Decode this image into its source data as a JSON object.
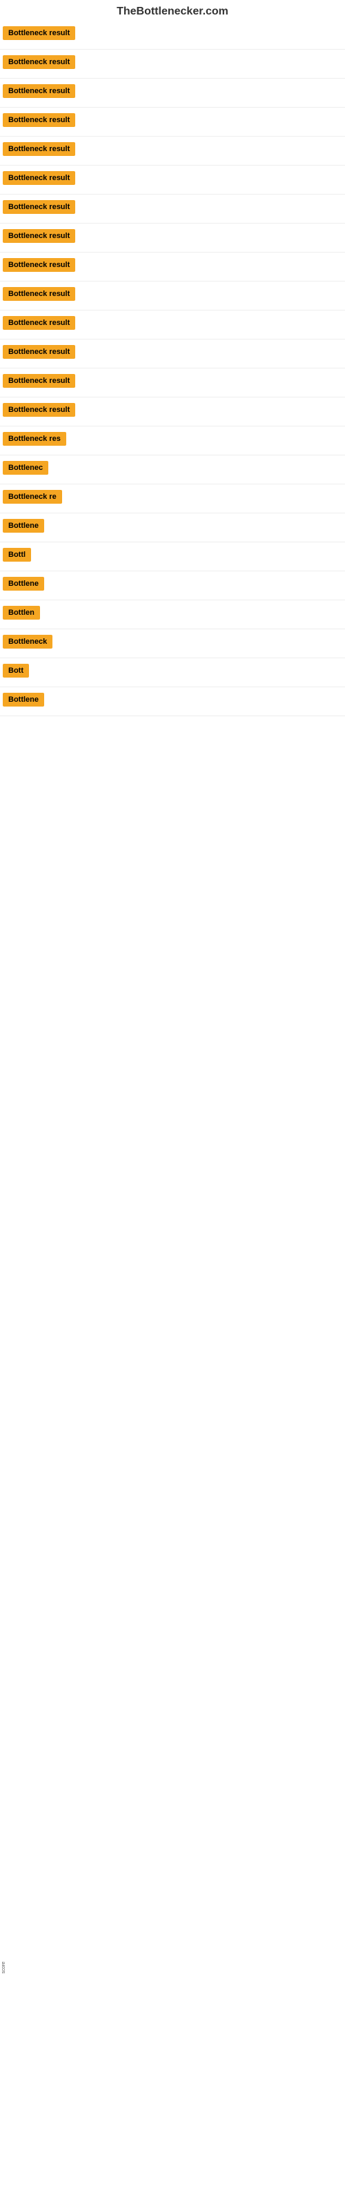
{
  "site": {
    "title": "TheBottlenecker.com"
  },
  "sections": [
    {
      "id": 1,
      "label": "Bottleneck result",
      "width": 130,
      "size": "normal"
    },
    {
      "id": 2,
      "label": "Bottleneck result",
      "width": 130,
      "size": "normal"
    },
    {
      "id": 3,
      "label": "Bottleneck result",
      "width": 130,
      "size": "normal"
    },
    {
      "id": 4,
      "label": "Bottleneck result",
      "width": 130,
      "size": "normal"
    },
    {
      "id": 5,
      "label": "Bottleneck result",
      "width": 130,
      "size": "normal"
    },
    {
      "id": 6,
      "label": "Bottleneck result",
      "width": 130,
      "size": "normal"
    },
    {
      "id": 7,
      "label": "Bottleneck result",
      "width": 130,
      "size": "normal"
    },
    {
      "id": 8,
      "label": "Bottleneck result",
      "width": 130,
      "size": "normal"
    },
    {
      "id": 9,
      "label": "Bottleneck result",
      "width": 130,
      "size": "normal"
    },
    {
      "id": 10,
      "label": "Bottleneck result",
      "width": 130,
      "size": "normal"
    },
    {
      "id": 11,
      "label": "Bottleneck result",
      "width": 130,
      "size": "normal"
    },
    {
      "id": 12,
      "label": "Bottleneck result",
      "width": 130,
      "size": "normal"
    },
    {
      "id": 13,
      "label": "Bottleneck result",
      "width": 130,
      "size": "normal"
    },
    {
      "id": 14,
      "label": "Bottleneck result",
      "width": 130,
      "size": "normal"
    },
    {
      "id": 15,
      "label": "Bottleneck res",
      "width": 110,
      "size": "normal"
    },
    {
      "id": 16,
      "label": "Bottlenec",
      "width": 80,
      "size": "normal"
    },
    {
      "id": 17,
      "label": "Bottleneck re",
      "width": 100,
      "size": "normal"
    },
    {
      "id": 18,
      "label": "Bottlene",
      "width": 72,
      "size": "normal"
    },
    {
      "id": 19,
      "label": "Bottl",
      "width": 52,
      "size": "normal"
    },
    {
      "id": 20,
      "label": "Bottlene",
      "width": 72,
      "size": "normal"
    },
    {
      "id": 21,
      "label": "Bottlen",
      "width": 65,
      "size": "normal"
    },
    {
      "id": 22,
      "label": "Bottleneck",
      "width": 85,
      "size": "normal"
    },
    {
      "id": 23,
      "label": "Bott",
      "width": 45,
      "size": "normal"
    },
    {
      "id": 24,
      "label": "Bottlene",
      "width": 72,
      "size": "normal"
    }
  ],
  "footer": {
    "label": "score"
  }
}
